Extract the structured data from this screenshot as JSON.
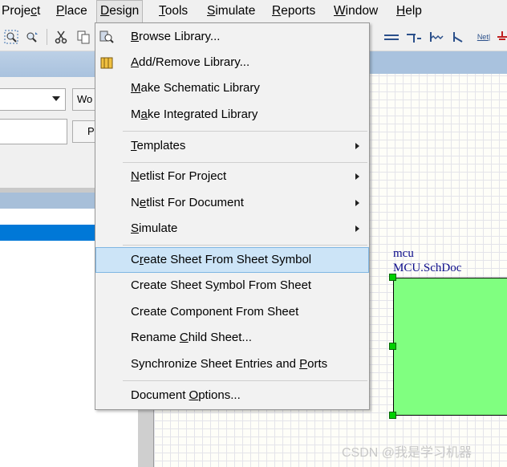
{
  "menubar": {
    "items": [
      {
        "pre": "Proje",
        "key": "c",
        "post": "t"
      },
      {
        "pre": "",
        "key": "P",
        "post": "lace"
      },
      {
        "pre": "",
        "key": "D",
        "post": "esign"
      },
      {
        "pre": "",
        "key": "T",
        "post": "ools"
      },
      {
        "pre": "",
        "key": "S",
        "post": "imulate"
      },
      {
        "pre": "",
        "key": "R",
        "post": "eports"
      },
      {
        "pre": "",
        "key": "W",
        "post": "indow"
      },
      {
        "pre": "",
        "key": "H",
        "post": "elp"
      }
    ],
    "active": "Design"
  },
  "toolbar": {
    "icons": [
      "zoom-fit-icon",
      "zoom-select-icon",
      "cut-icon",
      "copy-icon",
      "paste-icon",
      "bus-icon",
      "port-icon",
      "wire-icon",
      "power-icon",
      "net-label-icon",
      "gnd-icon"
    ],
    "net_label": "Net"
  },
  "left_panel": {
    "workspace_button": "Wo",
    "project_button": "P"
  },
  "design_menu": {
    "items": [
      {
        "pre": "",
        "key": "B",
        "post": "rowse Library...",
        "icon": "library-icon"
      },
      {
        "pre": "",
        "key": "A",
        "post": "dd/Remove Library...",
        "icon": "add-library-icon"
      },
      {
        "pre": "",
        "key": "M",
        "post": "ake Schematic Library"
      },
      {
        "pre": "M",
        "key": "a",
        "post": "ke Integrated Library"
      },
      {
        "pre": "",
        "key": "T",
        "post": "emplates",
        "submenu": true
      },
      {
        "pre": "",
        "key": "N",
        "post": "etlist For Project",
        "submenu": true
      },
      {
        "pre": "N",
        "key": "e",
        "post": "tlist For Document",
        "submenu": true
      },
      {
        "pre": "",
        "key": "S",
        "post": "imulate",
        "submenu": true
      },
      {
        "pre": "C",
        "key": "r",
        "post": "eate Sheet From Sheet Symbol",
        "highlighted": true
      },
      {
        "pre": "Create Sheet S",
        "key": "y",
        "post": "mbol From Sheet"
      },
      {
        "pre": "Create Component From Sheet",
        "key": "",
        "post": ""
      },
      {
        "pre": "Rename ",
        "key": "C",
        "post": "hild Sheet..."
      },
      {
        "pre": "Synchronize Sheet Entries and ",
        "key": "P",
        "post": "orts"
      },
      {
        "pre": "Document ",
        "key": "O",
        "post": "ptions..."
      }
    ]
  },
  "schematic": {
    "sheet_symbol": {
      "designator": "mcu",
      "filename": "MCU.SchDoc",
      "fill_color": "#80ff80"
    }
  },
  "watermark": "CSDN @我是学习机器"
}
